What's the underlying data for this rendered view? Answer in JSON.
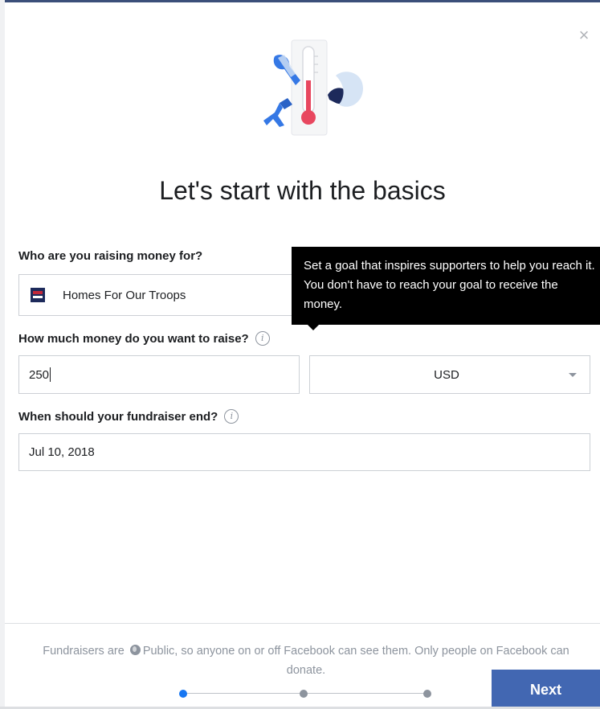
{
  "dialog": {
    "close_icon": "close-icon",
    "heading": "Let's start with the basics"
  },
  "beneficiary": {
    "label": "Who are you raising money for?",
    "value": "Homes For Our Troops"
  },
  "goal": {
    "label": "How much money do you want to raise?",
    "amount": "250",
    "currency": "USD"
  },
  "end_date": {
    "label": "When should your fundraiser end?",
    "value": "Jul 10, 2018"
  },
  "tooltip": {
    "text": "Set a goal that inspires supporters to help you reach it. You don't have to reach your goal to receive the money."
  },
  "footer": {
    "text_before": "Fundraisers are",
    "text_after": "Public, so anyone on or off Facebook can see them. Only people on Facebook can donate.",
    "globe_icon": "globe-icon",
    "next_label": "Next",
    "progress": {
      "current_step": 1,
      "total_steps": 3
    }
  },
  "colors": {
    "primary_button": "#4267b2",
    "active_step": "#1877f2",
    "tooltip_bg": "#000000",
    "thermometer": "#e8475f",
    "illustration_accent": "#3578e5"
  }
}
